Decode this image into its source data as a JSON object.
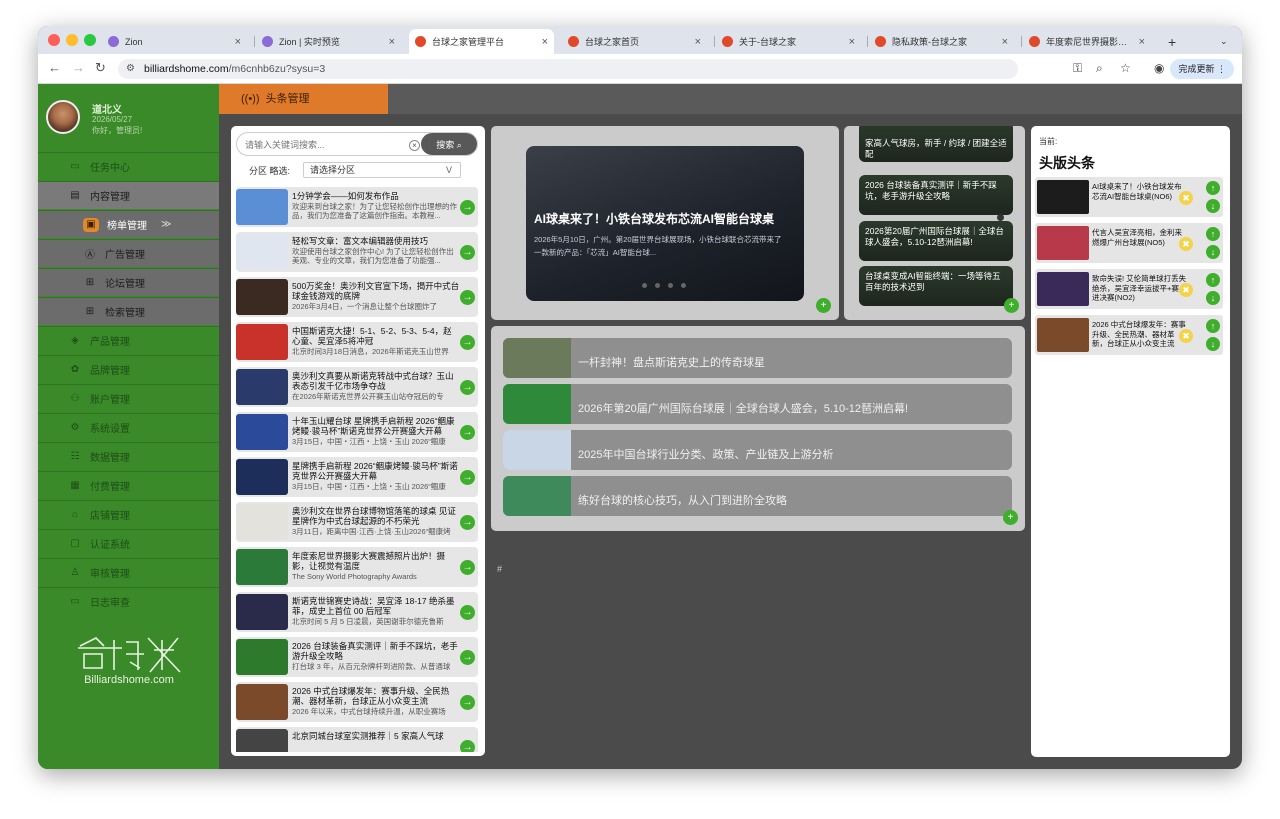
{
  "browser": {
    "tabs": [
      {
        "label": "Zion",
        "icon": "zion-icon",
        "color": "#8b6bd8"
      },
      {
        "label": "Zion | 实时预览",
        "icon": "zion-icon",
        "color": "#8b6bd8"
      },
      {
        "label": "台球之家管理平台",
        "icon": "billiards-icon",
        "color": "#e04a2a",
        "active": true
      },
      {
        "label": "台球之家首页",
        "icon": "billiards-icon",
        "color": "#e04a2a"
      },
      {
        "label": "关于-台球之家",
        "icon": "billiards-icon",
        "color": "#e04a2a"
      },
      {
        "label": "隐私政策-台球之家",
        "icon": "billiards-icon",
        "color": "#e04a2a"
      },
      {
        "label": "年度索尼世界摄影大赛震撼照片出炉！",
        "icon": "billiards-icon",
        "color": "#e04a2a"
      }
    ],
    "url_host": "billiardshome.com",
    "url_path": "/m6cnhb6zu?sysu=3",
    "update_label": "完成更新"
  },
  "user": {
    "name": "道北义",
    "date": "2026/05/27",
    "greeting": "你好，管理员!"
  },
  "sidebar": {
    "items": [
      {
        "label": "任务中心",
        "icon": "monitor-icon",
        "kind": "top"
      },
      {
        "label": "内容管理",
        "icon": "document-icon",
        "kind": "open"
      },
      {
        "label": "榜单管理",
        "icon": "ranking-icon",
        "kind": "cur"
      },
      {
        "label": "广告管理",
        "icon": "ad-icon",
        "kind": "sub"
      },
      {
        "label": "论坛管理",
        "icon": "grid-icon",
        "kind": "sub"
      },
      {
        "label": "检索管理",
        "icon": "grid-icon",
        "kind": "sub"
      },
      {
        "label": "产品管理",
        "icon": "cube-icon",
        "kind": "top"
      },
      {
        "label": "品牌管理",
        "icon": "brand-icon",
        "kind": "top"
      },
      {
        "label": "账户管理",
        "icon": "account-icon",
        "kind": "top"
      },
      {
        "label": "系统设置",
        "icon": "gear-icon",
        "kind": "top"
      },
      {
        "label": "数据管理",
        "icon": "data-icon",
        "kind": "top"
      },
      {
        "label": "付费管理",
        "icon": "pay-icon",
        "kind": "top"
      },
      {
        "label": "店铺管理",
        "icon": "store-icon",
        "kind": "top"
      },
      {
        "label": "认证系统",
        "icon": "id-icon",
        "kind": "top"
      },
      {
        "label": "审核管理",
        "icon": "review-icon",
        "kind": "top"
      },
      {
        "label": "日志审查",
        "icon": "log-icon",
        "kind": "top"
      }
    ],
    "logo_text": "Billiardshome.com"
  },
  "header": {
    "tab_label": "头条管理"
  },
  "search": {
    "placeholder": "请输入关键词搜索...",
    "button": "搜索"
  },
  "filter": {
    "label": "分区 略选:",
    "placeholder": "请选择分区"
  },
  "articles": [
    {
      "title": "1分钟学会——如何发布作品",
      "desc": "欢迎来到台球之家！为了让您轻松创作出理想的作品，我们为您准备了这篇创作指南。本教程...",
      "thumb": "#5a8fd6"
    },
    {
      "title": "轻松写文章：富文本编辑器使用技巧",
      "desc": "欢迎使用台球之家创作中心! 为了让您轻松创作出美观、专业的文章，我们为您准备了功能强...",
      "thumb": "#dfe6ef"
    },
    {
      "title": "500万奖金！奥沙利文官宣下场，揭开中式台球金钱游戏的底牌",
      "desc": "2026年3月4日，一个消息让整个台球圈炸了",
      "thumb": "#3a2a22"
    },
    {
      "title": "中国斯诺克大捷！5-1、5-2、5-3、5-4，赵心童、吴宜泽5将冲冠",
      "desc": "北京时间3月18日消息，2026年斯诺克玉山世界",
      "thumb": "#c8322a"
    },
    {
      "title": "奥沙利文真要从斯诺克转战中式台球？玉山表态引发千亿市场争夺战",
      "desc": "在2026年斯诺克世界公开赛玉山站夺冠后的专",
      "thumb": "#2a3a6a"
    },
    {
      "title": "十年玉山耀台球 星牌携手启新程 2026“鲴康烤鳗·骏马杯”斯诺克世界公开赛盛大开幕",
      "desc": "3月15日，中国・江西・上饶・玉山 2026“鲴康",
      "thumb": "#2c4a9a"
    },
    {
      "title": "星牌携手启新程 2026“鲴康烤鳗·骏马杯”斯诺克世界公开赛盛大开幕",
      "desc": "3月15日，中国・江西・上饶・玉山 2026“鲴康",
      "thumb": "#1e2e5a"
    },
    {
      "title": "奥沙利文在世界台球博物馆落笔的球桌 见证星牌作为中式台球起源的不朽荣光",
      "desc": "3月11日，距离中国·江西·上饶·玉山2026“鲴康烤",
      "thumb": "#e4e2dc"
    },
    {
      "title": "年度索尼世界摄影大赛震撼照片出炉！摄影，让视觉有温度",
      "desc": "The Sony World Photography Awards",
      "thumb": "#2c7a3a"
    },
    {
      "title": "斯诺克世锦赛史诗战：吴宜泽 18-17 绝杀墨菲，成史上首位 00 后冠军",
      "desc": "北京时间 5 月 5 日凌晨，英国谢菲尔德克鲁斯",
      "thumb": "#2a2a4a"
    },
    {
      "title": "2026 台球装备真实测评｜新手不踩坑，老手游升级全攻略",
      "desc": "打台球 3 年，从百元杂牌杆到进阶款、从普通球",
      "thumb": "#2e7a2c"
    },
    {
      "title": "2026 中式台球爆发年：赛事升级、全民热潮、器材革新，台球正从小众变主流",
      "desc": "2026 年以来，中式台球持续升温，从职业赛场",
      "thumb": "#7a4a2a"
    },
    {
      "title": "北京同城台球室实测推荐｜5 家高人气球",
      "desc": "",
      "thumb": "#444"
    }
  ],
  "carousel": {
    "title": "AI球桌来了！小铁台球发布芯流AI智能台球桌",
    "desc": "2026年5月10日，广州。第20届世界台球展现场，小铁台球联合芯流带来了一款新的产品：「芯流」AI智能台球..."
  },
  "right_cards": [
    {
      "text": "家高人气球房，新手 / 约球 / 团建全适配"
    },
    {
      "text": "2026 台球装备真实测评｜新手不踩坑，老手游升级全攻略"
    },
    {
      "text": "2026第20届广州国际台球展｜全球台球人盛会，5.10-12琶洲启幕!"
    },
    {
      "text": "台球桌变成AI智能终端：一场等待五百年的技术迟到"
    }
  ],
  "main_rows": [
    {
      "title": "一杆封神！盘点斯诺克史上的传奇球星",
      "thumb": "#6a7a5a"
    },
    {
      "title": "2026年第20届广州国际台球展｜全球台球人盛会，5.10-12琶洲启幕!",
      "thumb": "#2e8a3a"
    },
    {
      "title": "2025年中国台球行业分类、政策、产业链及上游分析",
      "thumb": "#c9d6e6"
    },
    {
      "title": "练好台球的核心技巧，从入门到进阶全攻略",
      "thumb": "#3f8a5a"
    }
  ],
  "hash_mark": "#",
  "featured": {
    "current_label": "当前:",
    "title": "头版头条",
    "items": [
      {
        "text": "AI球桌来了！小铁台球发布芯流AI智能台球桌(NO6)",
        "thumb": "#1c1c1c"
      },
      {
        "text": "代言人吴宜泽亮相，金利来燃爆广州台球展(NO5)",
        "thumb": "#b83a4a"
      },
      {
        "text": "致命失误! 艾伦简单球打丢失绝杀，吴宜泽幸运拔平+赛点进决赛(NO2)",
        "thumb": "#3a2a5a"
      },
      {
        "text": "2026 中式台球爆发年：赛事升级、全民热潮、器材革新，台球正从小众变主流(NO1)",
        "thumb": "#7a4a2a"
      }
    ]
  }
}
